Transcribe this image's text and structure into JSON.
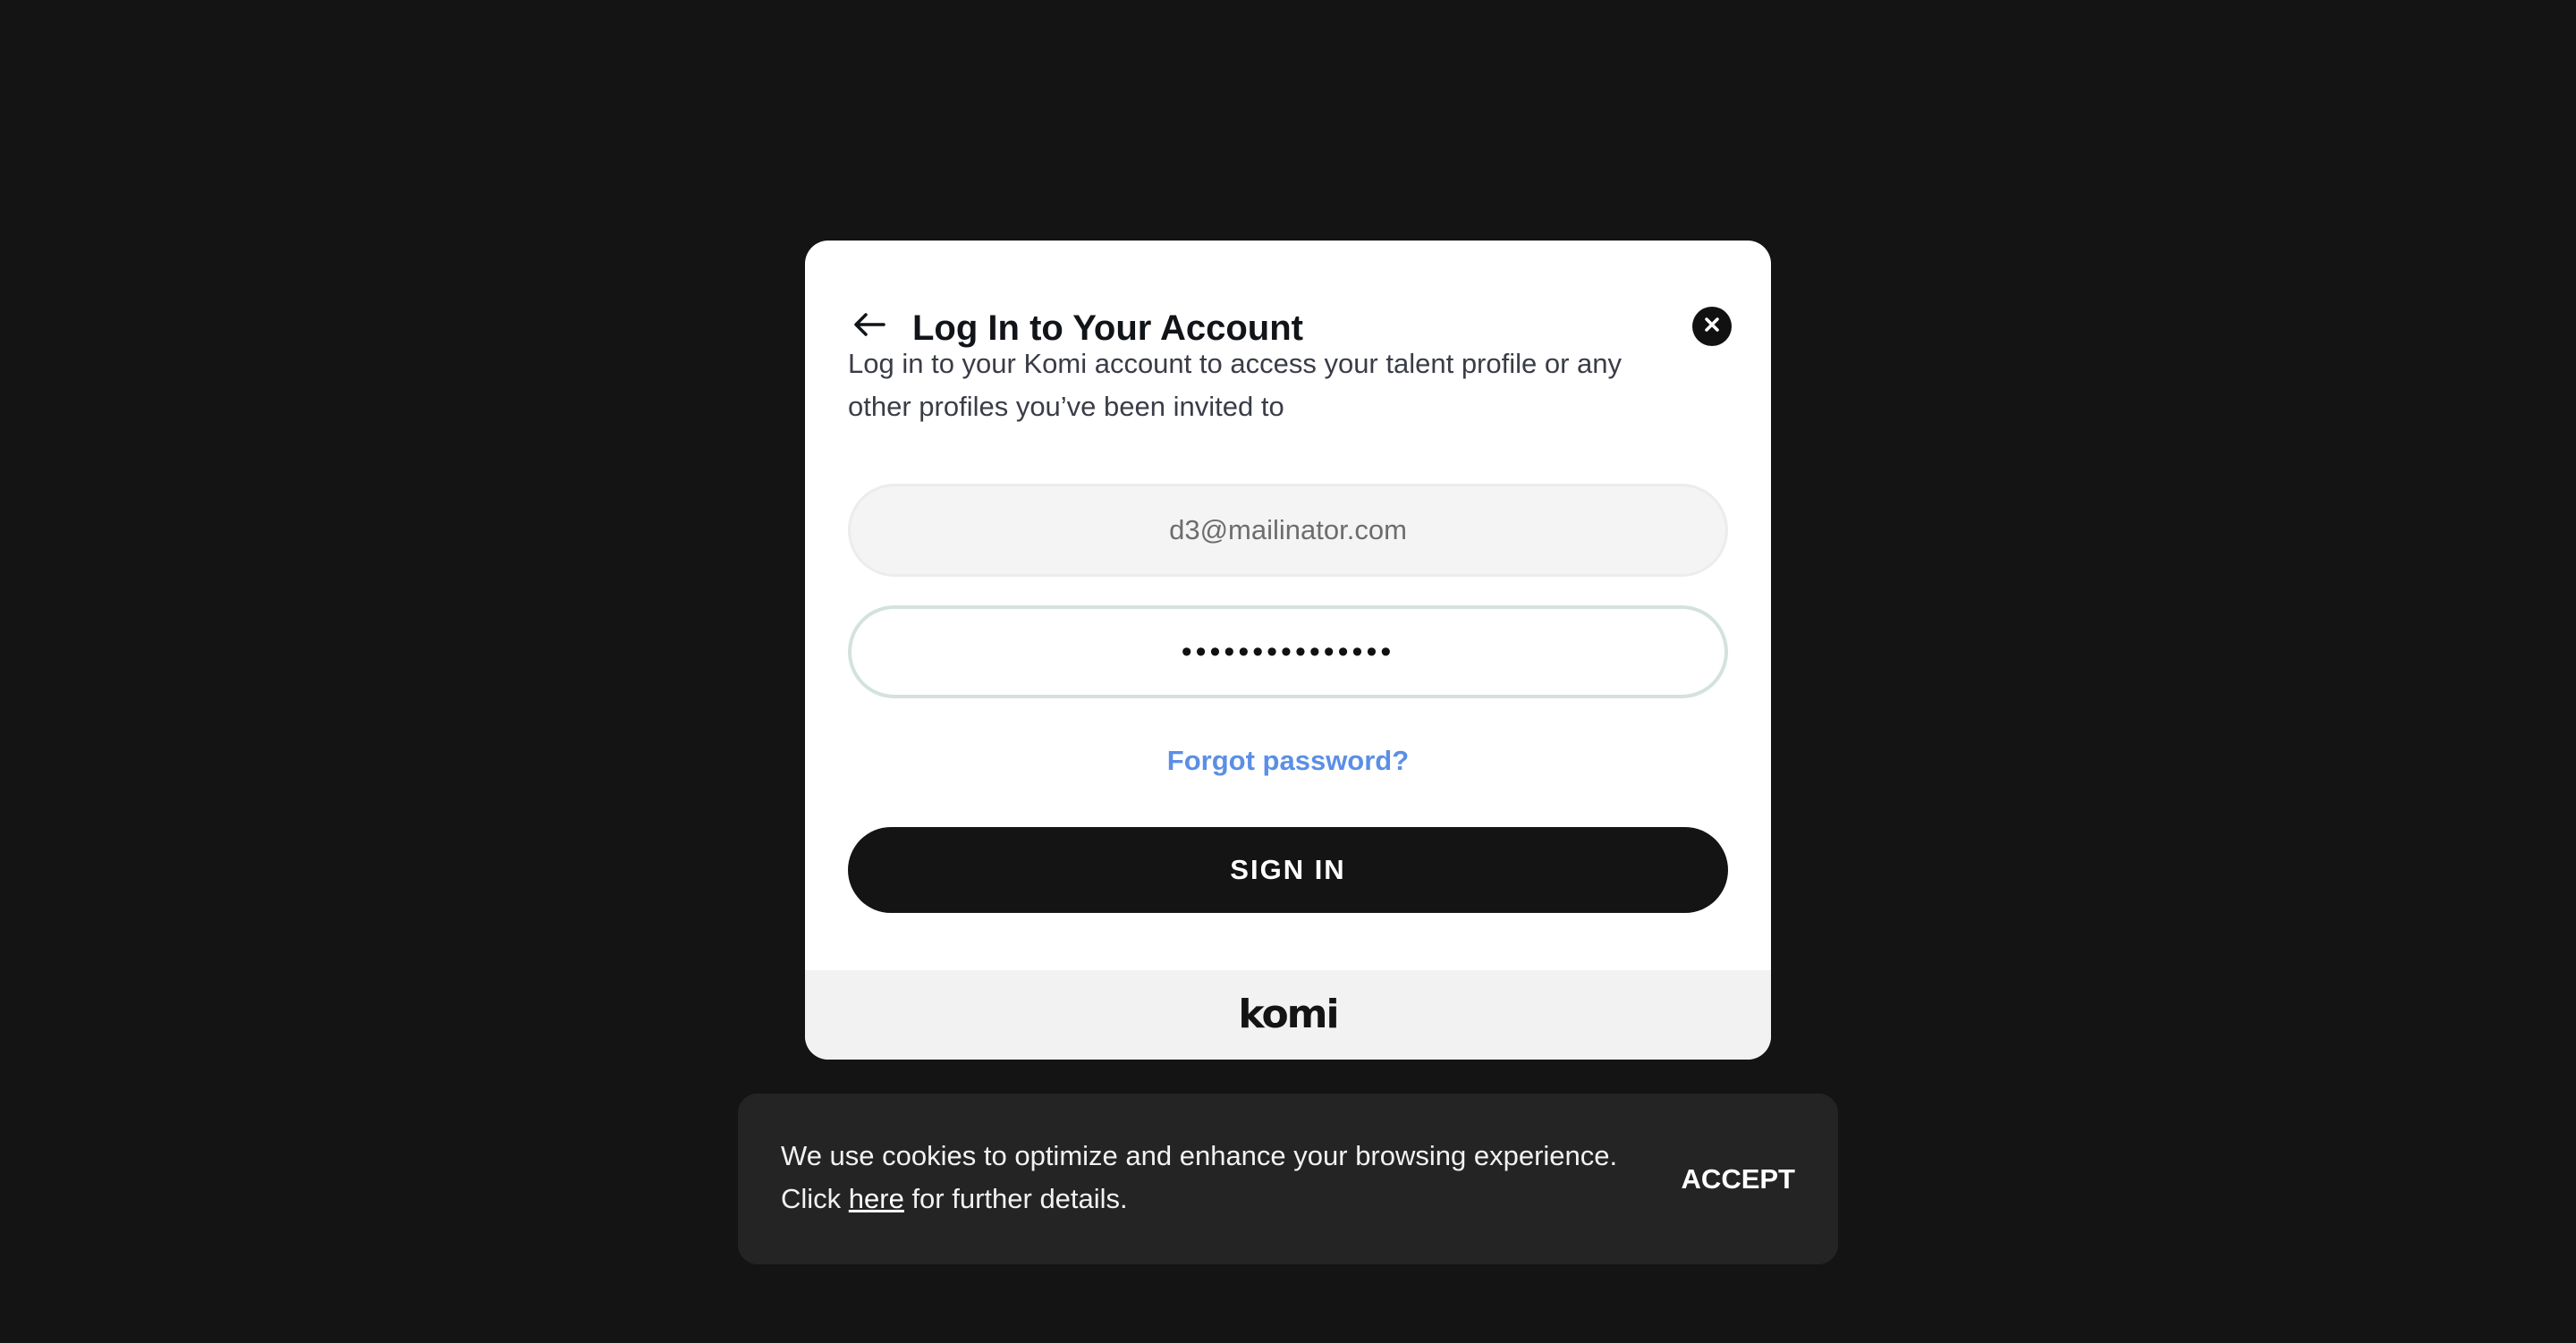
{
  "modal": {
    "title": "Log In to Your Account",
    "subtitle": "Log in to your Komi account to access your talent profile or any other profiles you’ve been invited to",
    "email_value": "d3@mailinator.com",
    "password_value": "•••••••••••••••",
    "forgot_label": "Forgot password?",
    "signin_label": "SIGN IN",
    "logo_text": "komi",
    "icons": {
      "back": "arrow-left-icon",
      "close": "close-icon"
    }
  },
  "cookie_banner": {
    "text_before": "We use cookies to optimize and enhance your browsing experience. Click ",
    "link_label": "here",
    "text_after": " for further details.",
    "accept_label": "ACCEPT"
  },
  "colors": {
    "background": "#141414",
    "modal_bg": "#ffffff",
    "link": "#5b8fe6",
    "button_bg": "#141414",
    "cookie_bg": "#242424"
  }
}
